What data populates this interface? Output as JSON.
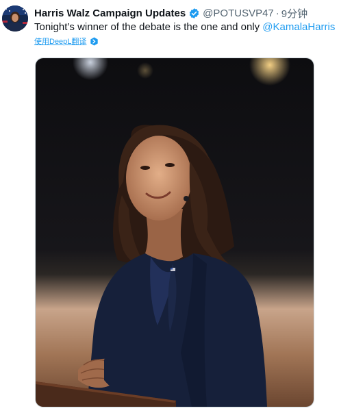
{
  "tweet": {
    "author_name": "Harris Walz Campaign Updates",
    "handle": "@POTUSVP47",
    "separator": "·",
    "time": "9分钟",
    "text_prefix": "Tonight’s winner of the debate is the one and only ",
    "mention": "@KamalaHarris",
    "translate_label": "使用DeepL翻译"
  },
  "icons": {
    "verified": "verified-badge-icon",
    "translate": "deepl-icon"
  },
  "colors": {
    "accent": "#1d9bf0",
    "text": "#0f1419",
    "muted": "#536471"
  }
}
